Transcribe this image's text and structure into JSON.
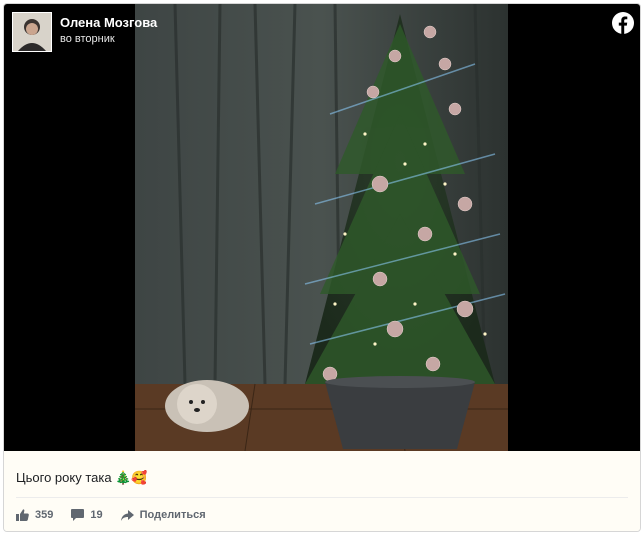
{
  "post": {
    "author": "Олена Мозгова",
    "time": "во вторник",
    "caption": "Цього року така 🎄🥰"
  },
  "actions": {
    "likes": "359",
    "comments": "19",
    "share_label": "Поделиться"
  },
  "icons": {
    "brand": "facebook-icon",
    "like": "thumbs-up-icon",
    "comment": "comment-icon",
    "share": "share-arrow-icon"
  },
  "colors": {
    "photo_bg": "#000000",
    "footer_bg": "#fffdf6",
    "facebook_logo": "#ffffff"
  }
}
